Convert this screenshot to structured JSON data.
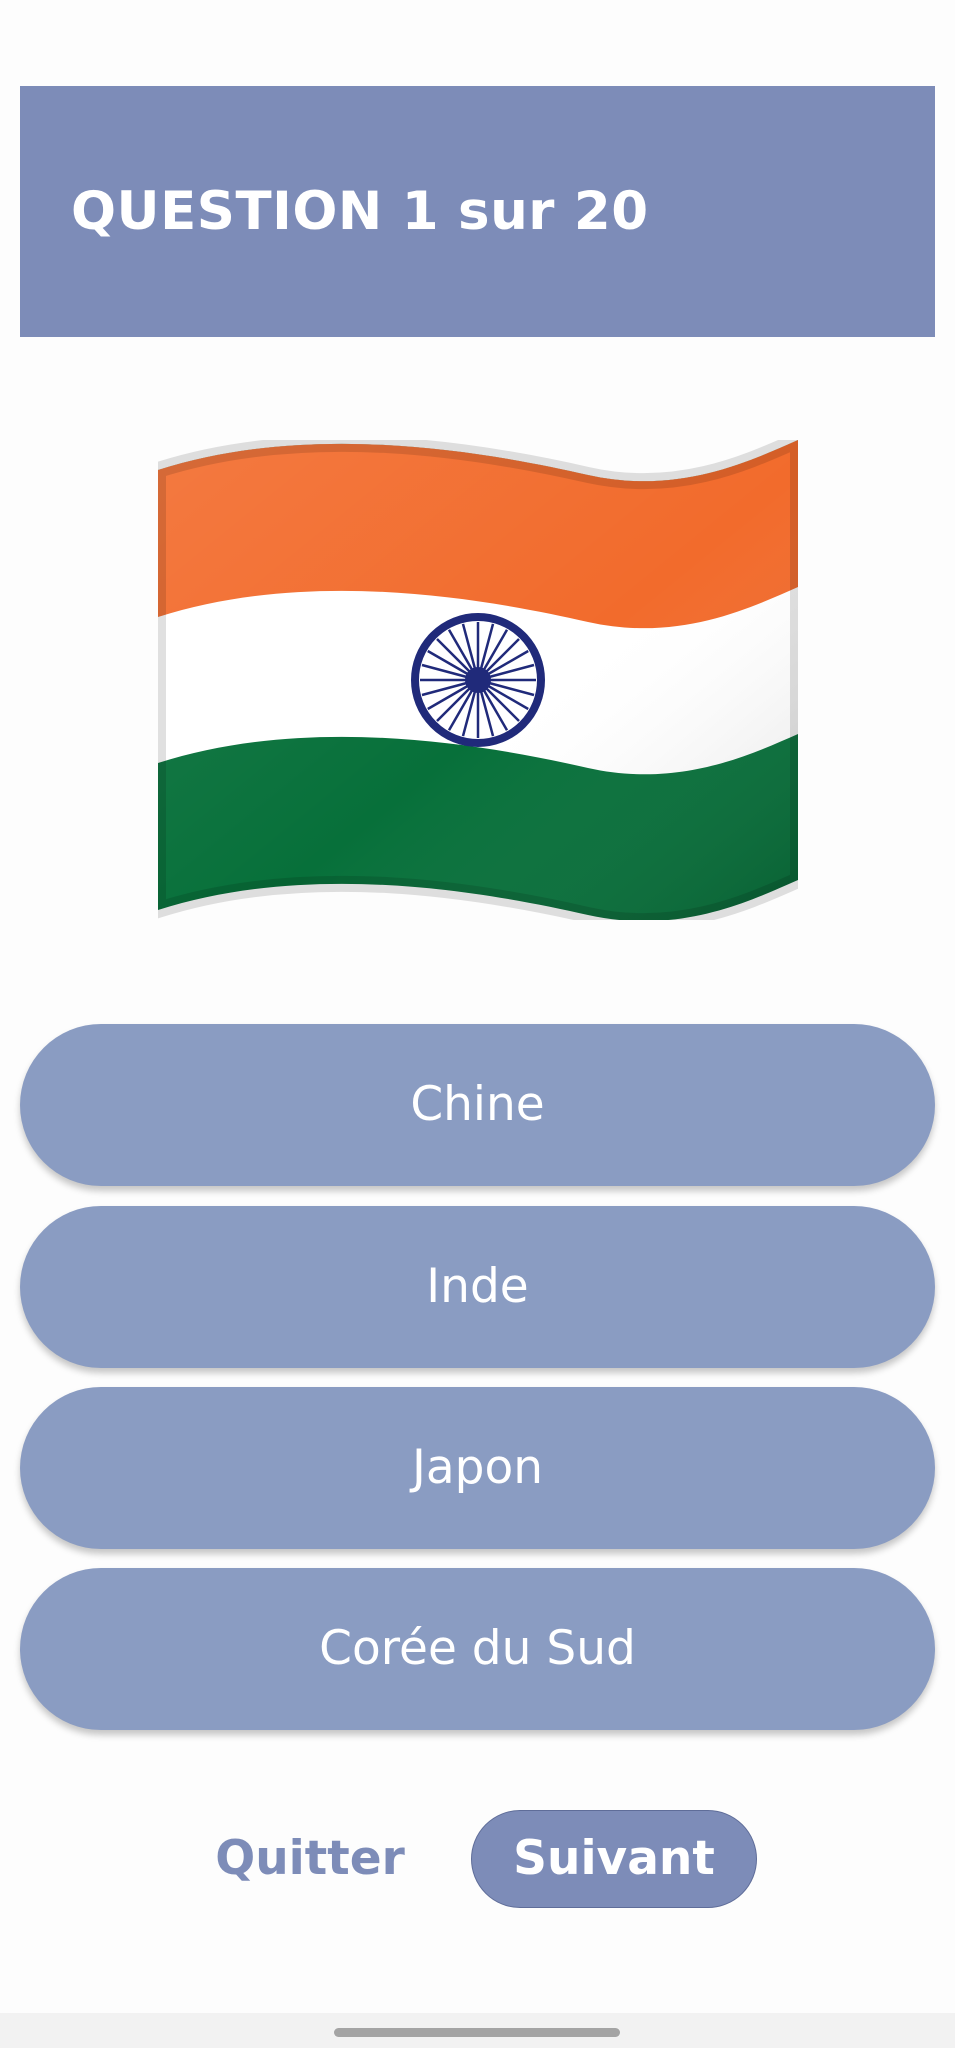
{
  "header": {
    "title": "QUESTION 1 sur 20"
  },
  "question": {
    "flag_icon": "india-flag-icon"
  },
  "answers": [
    {
      "label": "Chine"
    },
    {
      "label": "Inde"
    },
    {
      "label": "Japon"
    },
    {
      "label": "Corée du Sud"
    }
  ],
  "actions": {
    "quit_label": "Quitter",
    "next_label": "Suivant"
  },
  "colors": {
    "header_bg": "#7d8cb8",
    "answer_bg": "#8a9cc2",
    "accent": "#7d8cb8",
    "flag_saffron": "#f26b2c",
    "flag_white": "#ffffff",
    "flag_green": "#07703a",
    "flag_chakra": "#202a7a"
  }
}
